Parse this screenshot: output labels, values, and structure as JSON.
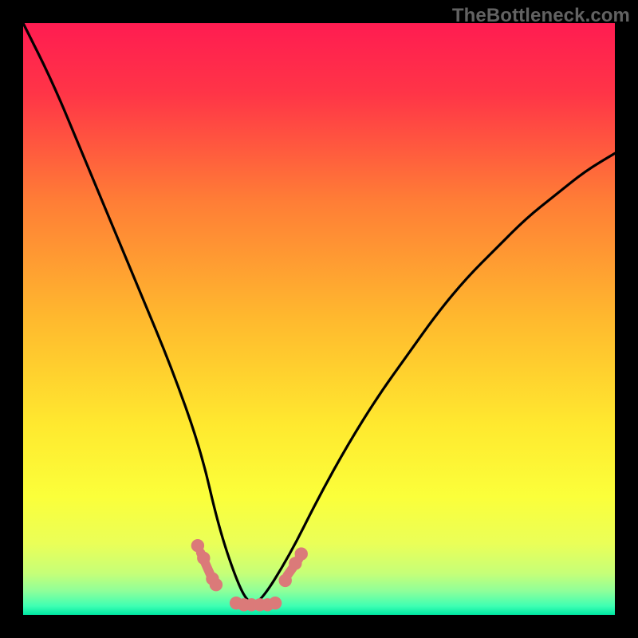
{
  "watermark": "TheBottleneck.com",
  "chart_data": {
    "type": "line",
    "title": "",
    "xlabel": "",
    "ylabel": "",
    "xlim": [
      0,
      100
    ],
    "ylim": [
      0,
      100
    ],
    "grid": false,
    "legend": false,
    "series": [
      {
        "name": "bottleneck-curve",
        "x": [
          0,
          5,
          10,
          15,
          20,
          25,
          30,
          33,
          36,
          38,
          40,
          45,
          50,
          55,
          60,
          65,
          70,
          75,
          80,
          85,
          90,
          95,
          100
        ],
        "values": [
          100,
          90,
          78,
          66,
          54,
          42,
          28,
          15,
          6,
          2,
          2,
          10,
          20,
          29,
          37,
          44,
          51,
          57,
          62,
          67,
          71,
          75,
          78
        ]
      },
      {
        "name": "highlight-segments",
        "note": "Short salmon segments near minimum",
        "x": [
          30.0,
          30.8,
          31.6,
          36.0,
          37.3,
          38.6,
          40.0,
          41.3,
          42.6,
          44.6,
          45.6,
          46.6
        ],
        "values": [
          10.5,
          8.7,
          6.9,
          2.0,
          1.7,
          1.7,
          1.7,
          1.7,
          2.0,
          6.6,
          8.0,
          9.5
        ]
      }
    ],
    "highlight_points": {
      "name": "highlight-dots",
      "x": [
        29.5,
        30.5,
        32.0,
        32.6,
        36,
        37.3,
        38.6,
        40,
        41.3,
        42.6,
        44.3,
        46.0,
        47.0
      ],
      "values": [
        11.7,
        9.6,
        6.1,
        5.1,
        2.0,
        1.7,
        1.7,
        1.7,
        1.7,
        2.0,
        5.8,
        8.7,
        10.3
      ]
    },
    "background_gradient_stops": [
      {
        "pct": 0,
        "color": "#ff1c51"
      },
      {
        "pct": 12,
        "color": "#ff3547"
      },
      {
        "pct": 30,
        "color": "#ff7d36"
      },
      {
        "pct": 50,
        "color": "#ffb92e"
      },
      {
        "pct": 68,
        "color": "#ffe92f"
      },
      {
        "pct": 80,
        "color": "#fbff3a"
      },
      {
        "pct": 88,
        "color": "#eaff58"
      },
      {
        "pct": 93,
        "color": "#c6ff78"
      },
      {
        "pct": 96,
        "color": "#8eff9a"
      },
      {
        "pct": 98.5,
        "color": "#3fffb3"
      },
      {
        "pct": 100,
        "color": "#00e8a3"
      }
    ],
    "line_color": "#000000",
    "highlight_color": "#db7a79"
  }
}
